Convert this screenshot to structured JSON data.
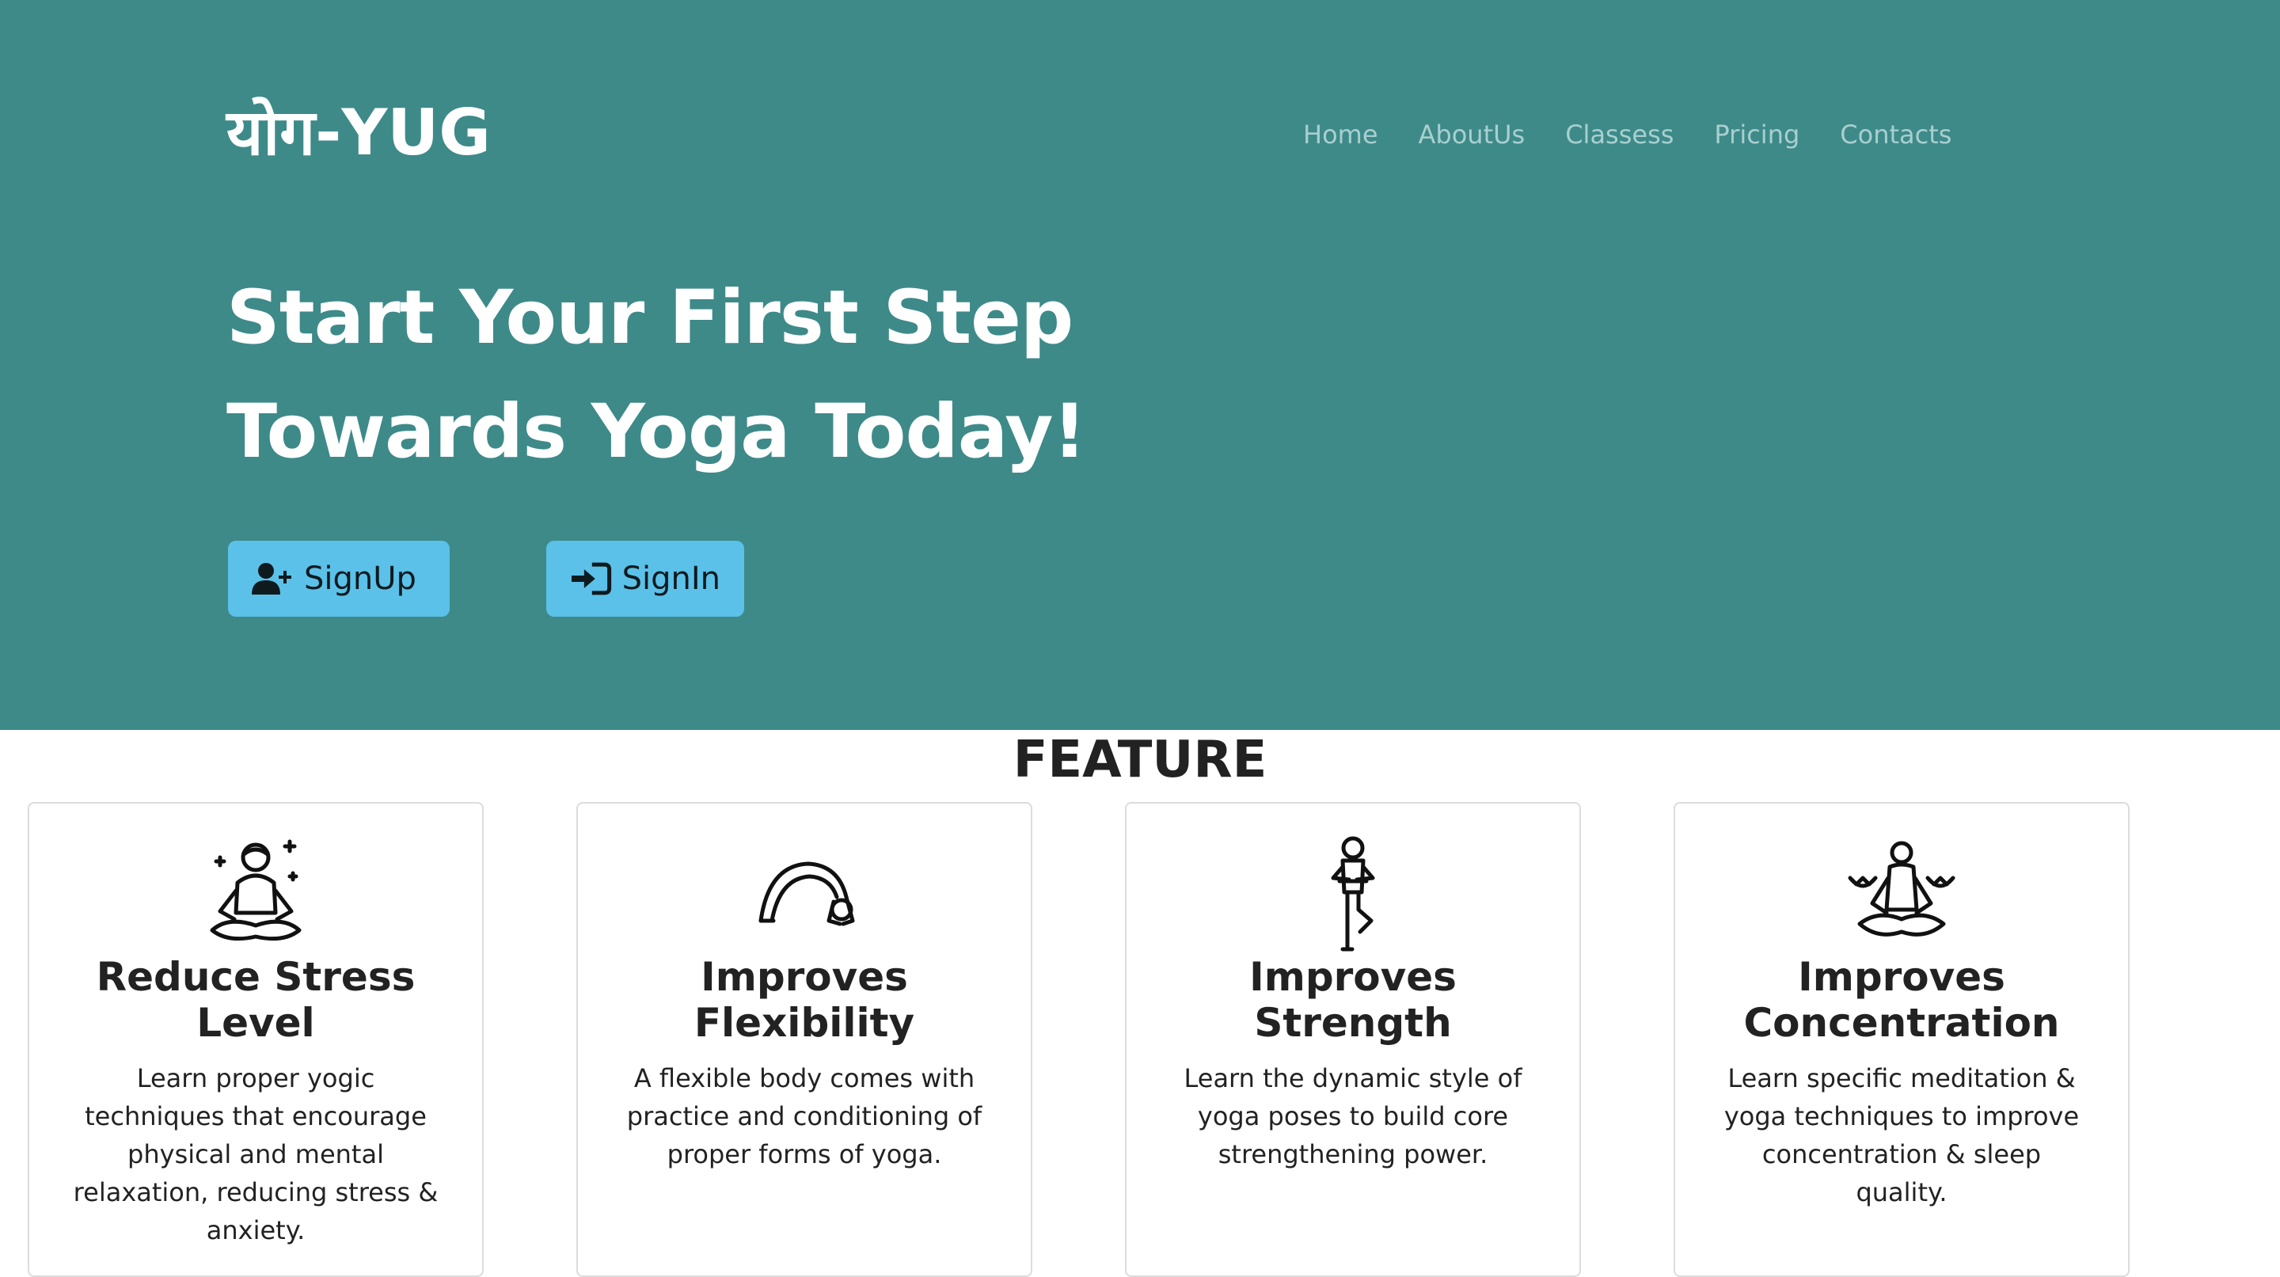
{
  "brand": {
    "logo": "योग-YUG"
  },
  "nav": {
    "items": [
      {
        "label": "Home"
      },
      {
        "label": "AboutUs"
      },
      {
        "label": "Classess"
      },
      {
        "label": "Pricing"
      },
      {
        "label": "Contacts"
      }
    ]
  },
  "hero": {
    "line1": "Start Your First Step",
    "line2": "Towards Yoga Today!",
    "signup_label": "SignUp",
    "signin_label": "SignIn",
    "signup_icon": "user-plus-icon",
    "signin_icon": "sign-in-icon"
  },
  "colors": {
    "hero_bg": "#3d8a89",
    "button_bg": "#5bc1e8",
    "nav_text": "#a9cfcf"
  },
  "features": {
    "title": "FEATURE",
    "cards": [
      {
        "icon": "meditation-icon",
        "title": "Reduce Stress Level",
        "text": "Learn proper yogic techniques that encourage physical and mental relaxation, reducing stress & anxiety."
      },
      {
        "icon": "backbend-pose-icon",
        "title": "Improves Flexibility",
        "text": "A flexible body comes with practice and conditioning of proper forms of yoga."
      },
      {
        "icon": "tree-pose-icon",
        "title": "Improves Strength",
        "text": "Learn the dynamic style of yoga poses to build core strengthening power."
      },
      {
        "icon": "lotus-meditation-icon",
        "title": "Improves Concentration",
        "text": "Learn specific meditation & yoga techniques to improve concentration & sleep quality."
      }
    ]
  }
}
